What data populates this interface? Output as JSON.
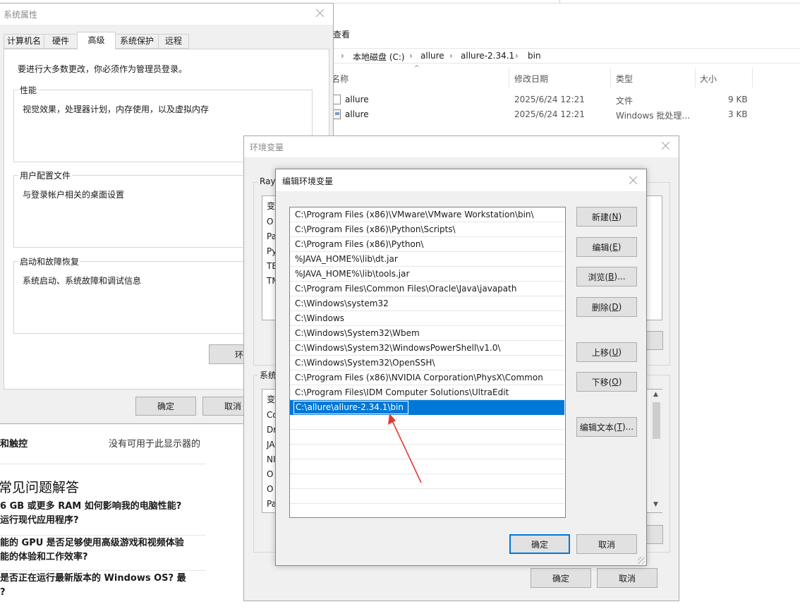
{
  "explorer": {
    "menu_view": "查看",
    "breadcrumb": [
      "本地磁盘 (C:)",
      "allure",
      "allure-2.34.1",
      "bin"
    ],
    "columns": [
      "名称",
      "修改日期",
      "类型",
      "大小"
    ],
    "files": [
      {
        "name": "allure",
        "date": "2025/6/24 12:21",
        "type": "文件",
        "size": "9 KB"
      },
      {
        "name": "allure",
        "date": "2025/6/24 12:21",
        "type": "Windows 批处理…",
        "size": "3 KB"
      }
    ]
  },
  "settings_bg": {
    "row1_label": "和触控",
    "row1_value": "没有可用于此显示器的",
    "faq_title": "常见问题解答",
    "faq_items": [
      [
        "6 GB 或更多 RAM 如何影响我的电脑性能?",
        "运行现代应用程序?"
      ],
      [
        "能的 GPU 是否足够使用高级游戏和视频体验",
        "能的体验和工作效率?"
      ],
      [
        "是否正在运行最新版本的 Windows OS? 最",
        "?"
      ]
    ]
  },
  "sysprops": {
    "title": "系统属性",
    "tabs": [
      "计算机名",
      "硬件",
      "高级",
      "系统保护",
      "远程"
    ],
    "active_tab": "高级",
    "admin_note": "要进行大多数更改，你必须作为管理员登录。",
    "performance": {
      "label": "性能",
      "desc": "视觉效果，处理器计划，内存使用，以及虚拟内存"
    },
    "profile": {
      "label": "用户配置文件",
      "desc": "与登录帐户相关的桌面设置"
    },
    "startup": {
      "label": "启动和故障恢复",
      "desc": "系统启动、系统故障和调试信息"
    },
    "env_button": "环",
    "ok": "确定",
    "cancel": "取消"
  },
  "envvars": {
    "title": "环境变量",
    "user_group": "Ray",
    "user_vars_clipped": [
      "变",
      "O",
      "Pa",
      "Py",
      "TE",
      "TM"
    ],
    "system_group": "系统",
    "system_vars_clipped": [
      "变",
      "Co",
      "Dr",
      "JA",
      "NI",
      "O",
      "O",
      "Pa"
    ],
    "ok": "确定",
    "cancel": "取消"
  },
  "editenv": {
    "title": "编辑环境变量",
    "items": [
      "C:\\Program Files (x86)\\VMware\\VMware Workstation\\bin\\",
      "C:\\Program Files (x86)\\Python\\Scripts\\",
      "C:\\Program Files (x86)\\Python\\",
      "%JAVA_HOME%\\lib\\dt.jar",
      "%JAVA_HOME%\\lib\\tools.jar",
      "C:\\Program Files\\Common Files\\Oracle\\Java\\javapath",
      "C:\\Windows\\system32",
      "C:\\Windows",
      "C:\\Windows\\System32\\Wbem",
      "C:\\Windows\\System32\\WindowsPowerShell\\v1.0\\",
      "C:\\Windows\\System32\\OpenSSH\\",
      "C:\\Program Files (x86)\\NVIDIA Corporation\\PhysX\\Common",
      "C:\\Program Files\\IDM Computer Solutions\\UltraEdit"
    ],
    "selected_value": "C:\\allure\\allure-2.34.1\\bin",
    "buttons": {
      "new": {
        "text": "新建(",
        "key": "N",
        "end": ")"
      },
      "edit": {
        "text": "编辑(",
        "key": "E",
        "end": ")"
      },
      "browse": {
        "text": "浏览(",
        "key": "B",
        "end": ")..."
      },
      "delete": {
        "text": "删除(",
        "key": "D",
        "end": ")"
      },
      "up": {
        "text": "上移(",
        "key": "U",
        "end": ")"
      },
      "down": {
        "text": "下移(",
        "key": "O",
        "end": ")"
      },
      "edit_text": {
        "text": "编辑文本(",
        "key": "T",
        "end": ")..."
      }
    },
    "ok": "确定",
    "cancel": "取消",
    "selection_color": "#0078d7",
    "arrow_color": "#e53935"
  }
}
